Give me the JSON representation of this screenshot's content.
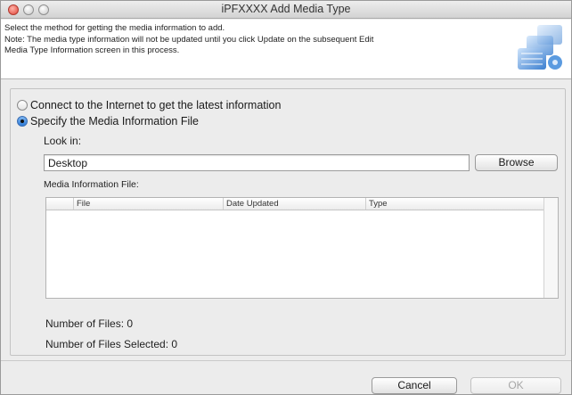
{
  "window": {
    "title": "iPFXXXX Add Media Type"
  },
  "header": {
    "line1": "Select the method for getting the media information to add.",
    "line2": "Note: The media type information will not be updated until you click Update on the subsequent Edit",
    "line3": "Media Type Information screen in this process.",
    "graphic_icon": "media-roll-icon",
    "accent": "#3b7fd0"
  },
  "options": {
    "internet_label": "Connect to the Internet to get the latest information",
    "file_label": "Specify the Media Information File",
    "selected": "file"
  },
  "look_in": {
    "label": "Look in:",
    "value": "Desktop",
    "browse_label": "Browse"
  },
  "media_file": {
    "label": "Media Information File:",
    "columns": [
      "File",
      "Date Updated",
      "Type"
    ],
    "rows": []
  },
  "counts": {
    "files_label": "Number of Files: 0",
    "selected_label": "Number of Files Selected: 0"
  },
  "footer": {
    "cancel_label": "Cancel",
    "ok_label": "OK"
  }
}
